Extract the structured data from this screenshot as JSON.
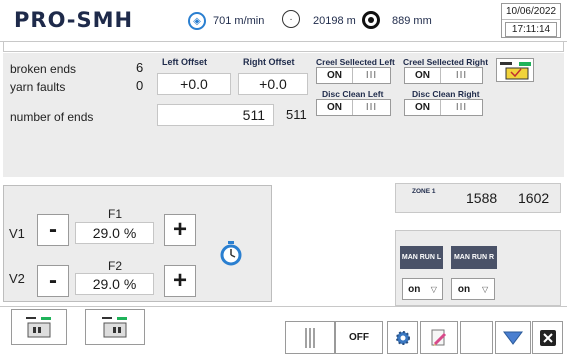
{
  "header": {
    "logo": {
      "part1": "PR",
      "part2": "O-SMH"
    },
    "speed": "701 m/min",
    "length": "20198 m",
    "diameter": "889 mm",
    "date": "10/06/2022",
    "time": "17:11:14"
  },
  "counters": {
    "broken_ends_label": "broken ends",
    "broken_ends_value": "6",
    "yarn_faults_label": "yarn faults",
    "yarn_faults_value": "0",
    "number_of_ends_label": "number of ends",
    "number_of_ends_input": "511",
    "number_of_ends_value": "511"
  },
  "offsets": {
    "left_label": "Left Offset",
    "left_value": "+0.0",
    "right_label": "Right Offset",
    "right_value": "+0.0"
  },
  "toggles": {
    "creel_left": {
      "label": "Creel Sellected Left",
      "on": "ON",
      "off": "III"
    },
    "creel_right": {
      "label": "Creel Sellected Right",
      "on": "ON",
      "off": "III"
    },
    "disc_left": {
      "label": "Disc Clean Left",
      "on": "ON",
      "off": "III"
    },
    "disc_right": {
      "label": "Disc Clean Right",
      "on": "ON",
      "off": "III"
    }
  },
  "valves": {
    "v1_label": "V1",
    "v2_label": "V2",
    "f1_label": "F1",
    "f1_value": "29.0 %",
    "f2_label": "F2",
    "f2_value": "29.0 %",
    "minus": "-",
    "plus": "+"
  },
  "zone": {
    "label": "ZONE 1",
    "value1": "1588",
    "value2": "1602"
  },
  "manual_run": {
    "left_label": "MAN RUN L",
    "right_label": "MAN RUN R",
    "left_select": "on",
    "right_select": "on"
  },
  "bottom": {
    "off_label": "OFF"
  },
  "colors": {
    "brand": "#1e2a4a",
    "panel": "#ececec",
    "accent_blue": "#2a7fd0",
    "man_run_bg": "#4a5268",
    "green": "#1fb35a"
  }
}
